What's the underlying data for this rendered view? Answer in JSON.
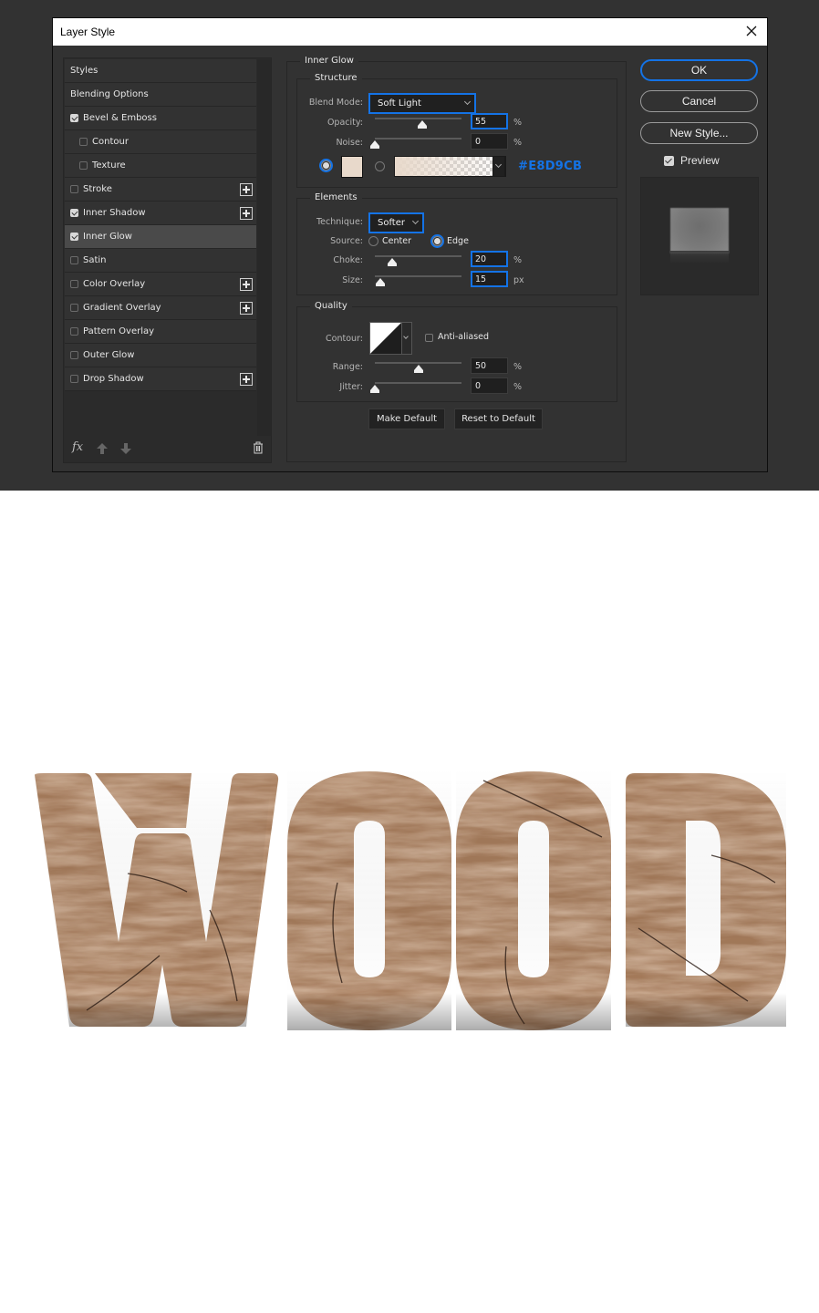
{
  "dialog": {
    "title": "Layer Style",
    "close_icon": "close-icon"
  },
  "styles_panel": {
    "items": [
      {
        "label": "Styles",
        "checkbox": false,
        "checked": false,
        "plus": false,
        "sub": false,
        "selected": false
      },
      {
        "label": "Blending Options",
        "checkbox": false,
        "checked": false,
        "plus": false,
        "sub": false,
        "selected": false
      },
      {
        "label": "Bevel & Emboss",
        "checkbox": true,
        "checked": true,
        "plus": false,
        "sub": false,
        "selected": false
      },
      {
        "label": "Contour",
        "checkbox": true,
        "checked": false,
        "plus": false,
        "sub": true,
        "selected": false
      },
      {
        "label": "Texture",
        "checkbox": true,
        "checked": false,
        "plus": false,
        "sub": true,
        "selected": false
      },
      {
        "label": "Stroke",
        "checkbox": true,
        "checked": false,
        "plus": true,
        "sub": false,
        "selected": false
      },
      {
        "label": "Inner Shadow",
        "checkbox": true,
        "checked": true,
        "plus": true,
        "sub": false,
        "selected": false
      },
      {
        "label": "Inner Glow",
        "checkbox": true,
        "checked": true,
        "plus": false,
        "sub": false,
        "selected": true
      },
      {
        "label": "Satin",
        "checkbox": true,
        "checked": false,
        "plus": false,
        "sub": false,
        "selected": false
      },
      {
        "label": "Color Overlay",
        "checkbox": true,
        "checked": false,
        "plus": true,
        "sub": false,
        "selected": false
      },
      {
        "label": "Gradient Overlay",
        "checkbox": true,
        "checked": false,
        "plus": true,
        "sub": false,
        "selected": false
      },
      {
        "label": "Pattern Overlay",
        "checkbox": true,
        "checked": false,
        "plus": false,
        "sub": false,
        "selected": false
      },
      {
        "label": "Outer Glow",
        "checkbox": true,
        "checked": false,
        "plus": false,
        "sub": false,
        "selected": false
      },
      {
        "label": "Drop Shadow",
        "checkbox": true,
        "checked": false,
        "plus": true,
        "sub": false,
        "selected": false
      }
    ],
    "footer": {
      "fx_label": "fx",
      "icons": [
        "fx-icon",
        "move-up-icon",
        "move-down-icon",
        "trash-icon"
      ]
    }
  },
  "inner_glow": {
    "title": "Inner Glow",
    "structure": {
      "title": "Structure",
      "blend_mode_label": "Blend Mode:",
      "blend_mode_value": "Soft Light",
      "opacity_label": "Opacity:",
      "opacity_value": "55",
      "opacity_unit": "%",
      "opacity_fraction": 0.55,
      "noise_label": "Noise:",
      "noise_value": "0",
      "noise_unit": "%",
      "noise_fraction": 0.0,
      "fill_mode": "color",
      "color_hex": "#E8D9CB",
      "color_label": "#E8D9CB"
    },
    "elements": {
      "title": "Elements",
      "technique_label": "Technique:",
      "technique_value": "Softer",
      "source_label": "Source:",
      "source_center": "Center",
      "source_edge": "Edge",
      "source_selected": "Edge",
      "choke_label": "Choke:",
      "choke_value": "20",
      "choke_unit": "%",
      "choke_fraction": 0.2,
      "size_label": "Size:",
      "size_value": "15",
      "size_unit": "px",
      "size_fraction": 0.06
    },
    "quality": {
      "title": "Quality",
      "contour_label": "Contour:",
      "anti_aliased_label": "Anti-aliased",
      "anti_aliased": false,
      "range_label": "Range:",
      "range_value": "50",
      "range_unit": "%",
      "range_fraction": 0.5,
      "jitter_label": "Jitter:",
      "jitter_value": "0",
      "jitter_unit": "%",
      "jitter_fraction": 0.0
    },
    "make_default": "Make Default",
    "reset_default": "Reset to Default"
  },
  "actions": {
    "ok": "OK",
    "cancel": "Cancel",
    "new_style": "New Style...",
    "preview_label": "Preview",
    "preview_checked": true
  },
  "artwork": {
    "text": "WOOD",
    "description": "Wood-textured 3D text"
  },
  "colors": {
    "accent": "#1473E6",
    "dialog_bg": "#323232",
    "glow_color": "#E8D9CB",
    "wood_light": "#B48866",
    "wood_dark": "#6E4A33"
  }
}
